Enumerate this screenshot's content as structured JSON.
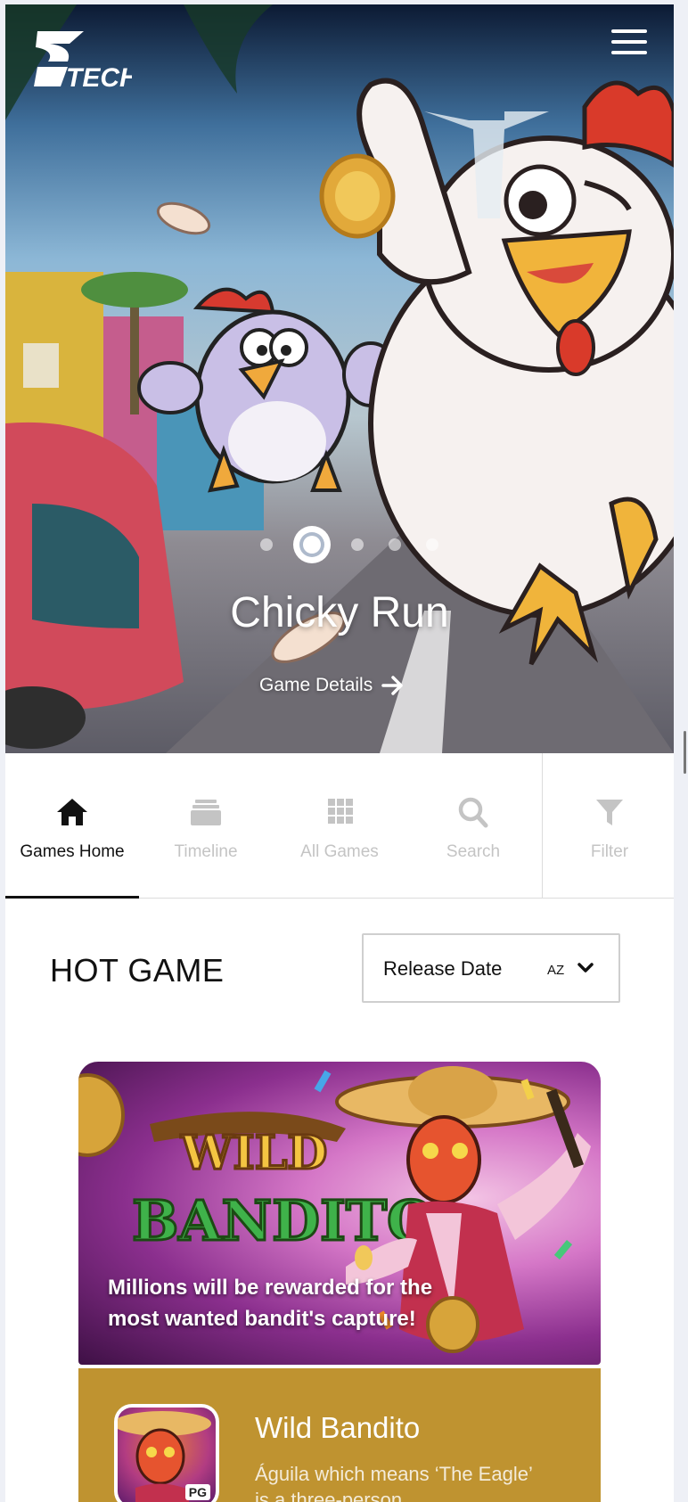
{
  "header": {
    "logo_text": "TECH",
    "menu_icon": "hamburger-menu-icon"
  },
  "hero": {
    "slide_count": 5,
    "active_slide_index": 1,
    "title": "Chicky Run",
    "details_link": "Game Details"
  },
  "tabs": [
    {
      "label": "Games Home",
      "icon": "home-icon",
      "active": true
    },
    {
      "label": "Timeline",
      "icon": "timeline-icon",
      "active": false
    },
    {
      "label": "All Games",
      "icon": "grid-icon",
      "active": false
    },
    {
      "label": "Search",
      "icon": "search-icon",
      "active": false
    },
    {
      "label": "Filter",
      "icon": "filter-icon",
      "active": false
    }
  ],
  "hot_game": {
    "title": "HOT GAME",
    "sort": {
      "selected": "Release Date",
      "order_label": "AZ"
    }
  },
  "featured_game": {
    "banner_logo_line1": "WILD",
    "banner_logo_line2": "BANDITO",
    "banner_tagline": "Millions will be rewarded for the most wanted bandit's capture!",
    "name": "Wild Bandito",
    "description": "Águila which means ‘The Eagle’ is a three-person…",
    "provider_badge": "PG",
    "info_color": "#bf9330"
  }
}
